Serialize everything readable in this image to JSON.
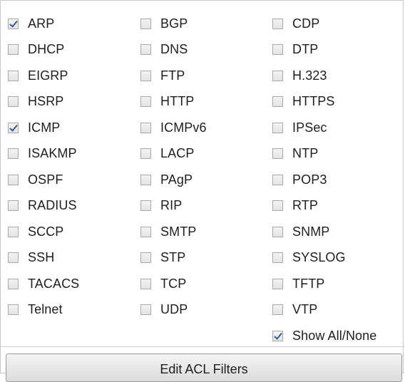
{
  "filters": {
    "columns": [
      [
        {
          "label": "ARP",
          "checked": true
        },
        {
          "label": "DHCP",
          "checked": false
        },
        {
          "label": "EIGRP",
          "checked": false
        },
        {
          "label": "HSRP",
          "checked": false
        },
        {
          "label": "ICMP",
          "checked": true
        },
        {
          "label": "ISAKMP",
          "checked": false
        },
        {
          "label": "OSPF",
          "checked": false
        },
        {
          "label": "RADIUS",
          "checked": false
        },
        {
          "label": "SCCP",
          "checked": false
        },
        {
          "label": "SSH",
          "checked": false
        },
        {
          "label": "TACACS",
          "checked": false
        },
        {
          "label": "Telnet",
          "checked": false
        }
      ],
      [
        {
          "label": "BGP",
          "checked": false
        },
        {
          "label": "DNS",
          "checked": false
        },
        {
          "label": "FTP",
          "checked": false
        },
        {
          "label": "HTTP",
          "checked": false
        },
        {
          "label": "ICMPv6",
          "checked": false
        },
        {
          "label": "LACP",
          "checked": false
        },
        {
          "label": "PAgP",
          "checked": false
        },
        {
          "label": "RIP",
          "checked": false
        },
        {
          "label": "SMTP",
          "checked": false
        },
        {
          "label": "STP",
          "checked": false
        },
        {
          "label": "TCP",
          "checked": false
        },
        {
          "label": "UDP",
          "checked": false
        }
      ],
      [
        {
          "label": "CDP",
          "checked": false
        },
        {
          "label": "DTP",
          "checked": false
        },
        {
          "label": "H.323",
          "checked": false
        },
        {
          "label": "HTTPS",
          "checked": false
        },
        {
          "label": "IPSec",
          "checked": false
        },
        {
          "label": "NTP",
          "checked": false
        },
        {
          "label": "POP3",
          "checked": false
        },
        {
          "label": "RTP",
          "checked": false
        },
        {
          "label": "SNMP",
          "checked": false
        },
        {
          "label": "SYSLOG",
          "checked": false
        },
        {
          "label": "TFTP",
          "checked": false
        },
        {
          "label": "VTP",
          "checked": false
        },
        {
          "label": "Show All/None",
          "checked": true
        }
      ]
    ]
  },
  "edit_button": {
    "label": "Edit ACL Filters"
  }
}
